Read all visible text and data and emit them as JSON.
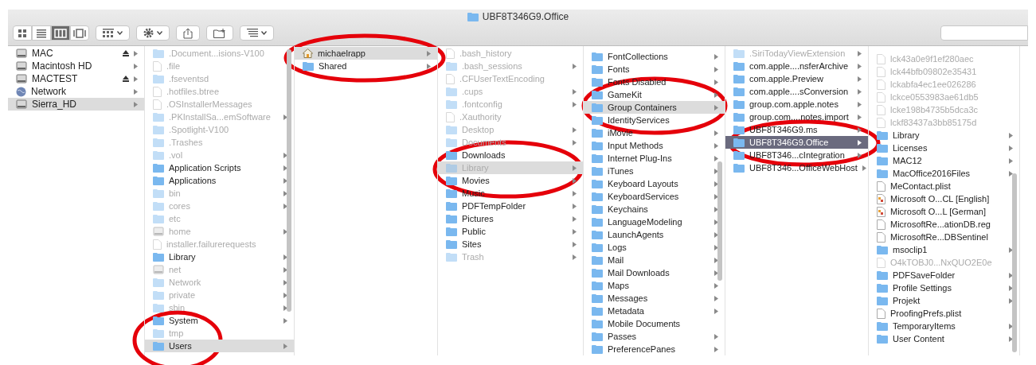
{
  "window": {
    "title": "UBF8T346G9.Office"
  },
  "toolbar": {
    "view_buttons": [
      {
        "kind": "icon",
        "selected": false
      },
      {
        "kind": "list",
        "selected": false
      },
      {
        "kind": "column",
        "selected": true
      },
      {
        "kind": "coverflow",
        "selected": false
      }
    ]
  },
  "columns": [
    {
      "items": [
        {
          "name": "MAC",
          "kind": "drive",
          "dim": false,
          "arrow": true,
          "eject": true,
          "selected": false
        },
        {
          "name": "Macintosh HD",
          "kind": "drive",
          "dim": false,
          "arrow": true,
          "eject": false,
          "selected": false
        },
        {
          "name": "MACTEST",
          "kind": "drive",
          "dim": false,
          "arrow": true,
          "eject": true,
          "selected": false
        },
        {
          "name": "Network",
          "kind": "globe",
          "dim": false,
          "arrow": true,
          "eject": false,
          "selected": false
        },
        {
          "name": "Sierra_HD",
          "kind": "drive",
          "dim": false,
          "arrow": true,
          "eject": false,
          "selected": true
        }
      ]
    },
    {
      "items": [
        {
          "name": ".Document...isions-V100",
          "kind": "folder",
          "dim": true,
          "arrow": false,
          "selected": false
        },
        {
          "name": ".file",
          "kind": "file",
          "dim": true,
          "arrow": false,
          "selected": false
        },
        {
          "name": ".fseventsd",
          "kind": "folder",
          "dim": true,
          "arrow": false,
          "selected": false
        },
        {
          "name": ".hotfiles.btree",
          "kind": "file",
          "dim": true,
          "arrow": false,
          "selected": false
        },
        {
          "name": ".OSInstallerMessages",
          "kind": "file",
          "dim": true,
          "arrow": false,
          "selected": false
        },
        {
          "name": ".PKInstallSa...emSoftware",
          "kind": "folder",
          "dim": true,
          "arrow": true,
          "selected": false
        },
        {
          "name": ".Spotlight-V100",
          "kind": "folder",
          "dim": true,
          "arrow": false,
          "selected": false
        },
        {
          "name": ".Trashes",
          "kind": "folder",
          "dim": true,
          "arrow": false,
          "selected": false
        },
        {
          "name": ".vol",
          "kind": "folder",
          "dim": true,
          "arrow": true,
          "selected": false
        },
        {
          "name": "Application Scripts",
          "kind": "folder",
          "dim": false,
          "arrow": true,
          "selected": false
        },
        {
          "name": "Applications",
          "kind": "folder",
          "dim": false,
          "arrow": true,
          "selected": false
        },
        {
          "name": "bin",
          "kind": "folder",
          "dim": true,
          "arrow": true,
          "selected": false
        },
        {
          "name": "cores",
          "kind": "folder",
          "dim": true,
          "arrow": true,
          "selected": false
        },
        {
          "name": "etc",
          "kind": "folder",
          "dim": true,
          "arrow": false,
          "selected": false
        },
        {
          "name": "home",
          "kind": "drive",
          "dim": true,
          "arrow": true,
          "selected": false
        },
        {
          "name": "installer.failurerequests",
          "kind": "file",
          "dim": true,
          "arrow": false,
          "selected": false
        },
        {
          "name": "Library",
          "kind": "folder",
          "dim": false,
          "arrow": true,
          "selected": false
        },
        {
          "name": "net",
          "kind": "drive",
          "dim": true,
          "arrow": true,
          "selected": false
        },
        {
          "name": "Network",
          "kind": "folder",
          "dim": true,
          "arrow": true,
          "selected": false
        },
        {
          "name": "private",
          "kind": "folder",
          "dim": true,
          "arrow": true,
          "selected": false
        },
        {
          "name": "sbin",
          "kind": "folder",
          "dim": true,
          "arrow": true,
          "selected": false
        },
        {
          "name": "System",
          "kind": "folder",
          "dim": false,
          "arrow": true,
          "selected": false
        },
        {
          "name": "tmp",
          "kind": "folder",
          "dim": true,
          "arrow": false,
          "selected": false
        },
        {
          "name": "Users",
          "kind": "folder",
          "dim": false,
          "arrow": true,
          "selected": true
        }
      ]
    },
    {
      "items": [
        {
          "name": "michaelrapp",
          "kind": "home",
          "dim": false,
          "arrow": true,
          "selected": true
        },
        {
          "name": "Shared",
          "kind": "folder",
          "dim": false,
          "arrow": true,
          "selected": false
        }
      ]
    },
    {
      "items": [
        {
          "name": ".bash_history",
          "kind": "file",
          "dim": true,
          "arrow": false,
          "selected": false
        },
        {
          "name": ".bash_sessions",
          "kind": "folder",
          "dim": true,
          "arrow": true,
          "selected": false
        },
        {
          "name": ".CFUserTextEncoding",
          "kind": "file",
          "dim": true,
          "arrow": false,
          "selected": false
        },
        {
          "name": ".cups",
          "kind": "folder",
          "dim": true,
          "arrow": true,
          "selected": false
        },
        {
          "name": ".fontconfig",
          "kind": "folder",
          "dim": true,
          "arrow": true,
          "selected": false
        },
        {
          "name": ".Xauthority",
          "kind": "file",
          "dim": true,
          "arrow": false,
          "selected": false
        },
        {
          "name": "Desktop",
          "kind": "folder",
          "dim": true,
          "arrow": true,
          "selected": false
        },
        {
          "name": "Documents",
          "kind": "folder",
          "dim": true,
          "arrow": true,
          "selected": false
        },
        {
          "name": "Downloads",
          "kind": "folder",
          "dim": false,
          "arrow": false,
          "selected": false
        },
        {
          "name": "Library",
          "kind": "folder",
          "dim": true,
          "arrow": true,
          "selected": true
        },
        {
          "name": "Movies",
          "kind": "folder",
          "dim": false,
          "arrow": true,
          "selected": false
        },
        {
          "name": "Music",
          "kind": "folder",
          "dim": false,
          "arrow": true,
          "selected": false
        },
        {
          "name": "PDFTempFolder",
          "kind": "folder",
          "dim": false,
          "arrow": true,
          "selected": false
        },
        {
          "name": "Pictures",
          "kind": "folder",
          "dim": false,
          "arrow": true,
          "selected": false
        },
        {
          "name": "Public",
          "kind": "folder",
          "dim": false,
          "arrow": true,
          "selected": false
        },
        {
          "name": "Sites",
          "kind": "folder",
          "dim": false,
          "arrow": true,
          "selected": false
        },
        {
          "name": "Trash",
          "kind": "folder",
          "dim": true,
          "arrow": true,
          "selected": false
        }
      ]
    },
    {
      "items": [
        {
          "name": "FontCollections",
          "kind": "folder",
          "dim": false,
          "arrow": true,
          "selected": false
        },
        {
          "name": "Fonts",
          "kind": "folder",
          "dim": false,
          "arrow": true,
          "selected": false
        },
        {
          "name": "Fonts Disabled",
          "kind": "folder",
          "dim": false,
          "arrow": true,
          "selected": false
        },
        {
          "name": "GameKit",
          "kind": "folder",
          "dim": false,
          "arrow": true,
          "selected": false
        },
        {
          "name": "Group Containers",
          "kind": "folder",
          "dim": false,
          "arrow": true,
          "selected": true
        },
        {
          "name": "IdentityServices",
          "kind": "folder",
          "dim": false,
          "arrow": false,
          "selected": false
        },
        {
          "name": "iMovie",
          "kind": "folder",
          "dim": false,
          "arrow": true,
          "selected": false
        },
        {
          "name": "Input Methods",
          "kind": "folder",
          "dim": false,
          "arrow": true,
          "selected": false
        },
        {
          "name": "Internet Plug-Ins",
          "kind": "folder",
          "dim": false,
          "arrow": true,
          "selected": false
        },
        {
          "name": "iTunes",
          "kind": "folder",
          "dim": false,
          "arrow": true,
          "selected": false
        },
        {
          "name": "Keyboard Layouts",
          "kind": "folder",
          "dim": false,
          "arrow": true,
          "selected": false
        },
        {
          "name": "KeyboardServices",
          "kind": "folder",
          "dim": false,
          "arrow": true,
          "selected": false
        },
        {
          "name": "Keychains",
          "kind": "folder",
          "dim": false,
          "arrow": true,
          "selected": false
        },
        {
          "name": "LanguageModeling",
          "kind": "folder",
          "dim": false,
          "arrow": true,
          "selected": false
        },
        {
          "name": "LaunchAgents",
          "kind": "folder",
          "dim": false,
          "arrow": true,
          "selected": false
        },
        {
          "name": "Logs",
          "kind": "folder",
          "dim": false,
          "arrow": true,
          "selected": false
        },
        {
          "name": "Mail",
          "kind": "folder",
          "dim": false,
          "arrow": true,
          "selected": false
        },
        {
          "name": "Mail Downloads",
          "kind": "folder",
          "dim": false,
          "arrow": true,
          "selected": false
        },
        {
          "name": "Maps",
          "kind": "folder",
          "dim": false,
          "arrow": true,
          "selected": false
        },
        {
          "name": "Messages",
          "kind": "folder",
          "dim": false,
          "arrow": true,
          "selected": false
        },
        {
          "name": "Metadata",
          "kind": "folder",
          "dim": false,
          "arrow": true,
          "selected": false
        },
        {
          "name": "Mobile Documents",
          "kind": "folder",
          "dim": false,
          "arrow": false,
          "selected": false
        },
        {
          "name": "Passes",
          "kind": "folder",
          "dim": false,
          "arrow": true,
          "selected": false
        },
        {
          "name": "PreferencePanes",
          "kind": "folder",
          "dim": false,
          "arrow": true,
          "selected": false
        }
      ]
    },
    {
      "focused": true,
      "items": [
        {
          "name": ".SiriTodayViewExtension",
          "kind": "folder",
          "dim": true,
          "arrow": true,
          "selected": false
        },
        {
          "name": "com.apple....nsferArchive",
          "kind": "folder",
          "dim": false,
          "arrow": true,
          "selected": false
        },
        {
          "name": "com.apple.Preview",
          "kind": "folder",
          "dim": false,
          "arrow": true,
          "selected": false
        },
        {
          "name": "com.apple....sConversion",
          "kind": "folder",
          "dim": false,
          "arrow": true,
          "selected": false
        },
        {
          "name": "group.com.apple.notes",
          "kind": "folder",
          "dim": false,
          "arrow": true,
          "selected": false
        },
        {
          "name": "group.com....notes.import",
          "kind": "folder",
          "dim": false,
          "arrow": true,
          "selected": false
        },
        {
          "name": "UBF8T346G9.ms",
          "kind": "folder",
          "dim": false,
          "arrow": true,
          "selected": false
        },
        {
          "name": "UBF8T346G9.Office",
          "kind": "folder",
          "dim": false,
          "arrow": true,
          "selected": true
        },
        {
          "name": "UBF8T346...cIntegration",
          "kind": "folder",
          "dim": false,
          "arrow": true,
          "selected": false
        },
        {
          "name": "UBF8T346...OfficeWebHost",
          "kind": "folder",
          "dim": false,
          "arrow": true,
          "selected": false
        }
      ]
    },
    {
      "items": [
        {
          "name": "lck43a0e9f1ef280aec",
          "kind": "file",
          "dim": true,
          "arrow": false,
          "selected": false
        },
        {
          "name": "lck44bfb09802e35431",
          "kind": "file",
          "dim": true,
          "arrow": false,
          "selected": false
        },
        {
          "name": "lckabfa4ec1ee026286",
          "kind": "file",
          "dim": true,
          "arrow": false,
          "selected": false
        },
        {
          "name": "lckce0553983ae61db5",
          "kind": "file",
          "dim": true,
          "arrow": false,
          "selected": false
        },
        {
          "name": "lcke198b4735b5dca3c",
          "kind": "file",
          "dim": true,
          "arrow": false,
          "selected": false
        },
        {
          "name": "lckf83437a3bb85175d",
          "kind": "file",
          "dim": true,
          "arrow": false,
          "selected": false
        },
        {
          "name": "Library",
          "kind": "folder",
          "dim": false,
          "arrow": true,
          "selected": false
        },
        {
          "name": "Licenses",
          "kind": "folder",
          "dim": false,
          "arrow": true,
          "selected": false
        },
        {
          "name": "MAC12",
          "kind": "folder",
          "dim": false,
          "arrow": true,
          "selected": false
        },
        {
          "name": "MacOffice2016Files",
          "kind": "folder",
          "dim": false,
          "arrow": true,
          "selected": false
        },
        {
          "name": "MeContact.plist",
          "kind": "file",
          "dim": false,
          "arrow": false,
          "selected": false
        },
        {
          "name": "Microsoft O...CL [English]",
          "kind": "document",
          "dim": false,
          "arrow": false,
          "selected": false
        },
        {
          "name": "Microsoft O...L [German]",
          "kind": "document",
          "dim": false,
          "arrow": false,
          "selected": false
        },
        {
          "name": "MicrosoftRe...ationDB.reg",
          "kind": "file",
          "dim": false,
          "arrow": false,
          "selected": false
        },
        {
          "name": "MicrosoftRe...DBSentinel",
          "kind": "file",
          "dim": false,
          "arrow": false,
          "selected": false
        },
        {
          "name": "msoclip1",
          "kind": "folder",
          "dim": false,
          "arrow": true,
          "selected": false
        },
        {
          "name": "O4kTOBJ0...NxQUO2E0e",
          "kind": "file",
          "dim": true,
          "arrow": false,
          "selected": false
        },
        {
          "name": "PDFSaveFolder",
          "kind": "folder",
          "dim": false,
          "arrow": true,
          "selected": false
        },
        {
          "name": "Profile Settings",
          "kind": "folder",
          "dim": false,
          "arrow": true,
          "selected": false
        },
        {
          "name": "Projekt",
          "kind": "folder",
          "dim": false,
          "arrow": true,
          "selected": false
        },
        {
          "name": "ProofingPrefs.plist",
          "kind": "file",
          "dim": false,
          "arrow": false,
          "selected": false
        },
        {
          "name": "TemporaryItems",
          "kind": "folder",
          "dim": false,
          "arrow": true,
          "selected": false
        },
        {
          "name": "User Content",
          "kind": "folder",
          "dim": false,
          "arrow": true,
          "selected": false
        }
      ]
    }
  ]
}
